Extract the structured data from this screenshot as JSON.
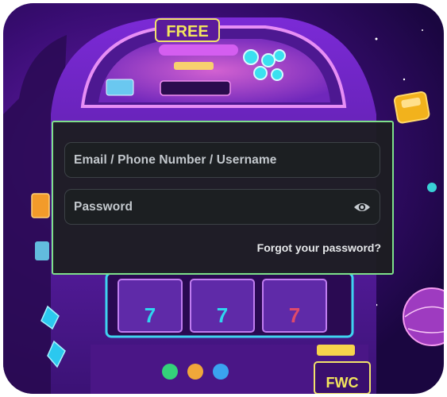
{
  "login": {
    "email_placeholder": "Email / Phone Number / Username",
    "password_placeholder": "Password",
    "forgot_password_label": "Forgot your password?"
  },
  "background": {
    "slot_top_sign": "FREE",
    "slot_bottom_sign": "FWC",
    "icons": [
      "slot-machine-art",
      "show-password-eye-icon"
    ]
  },
  "colors": {
    "panel_border": "#7ee08a",
    "panel_bg": "#1c1e21",
    "text": "#d8dde2"
  }
}
